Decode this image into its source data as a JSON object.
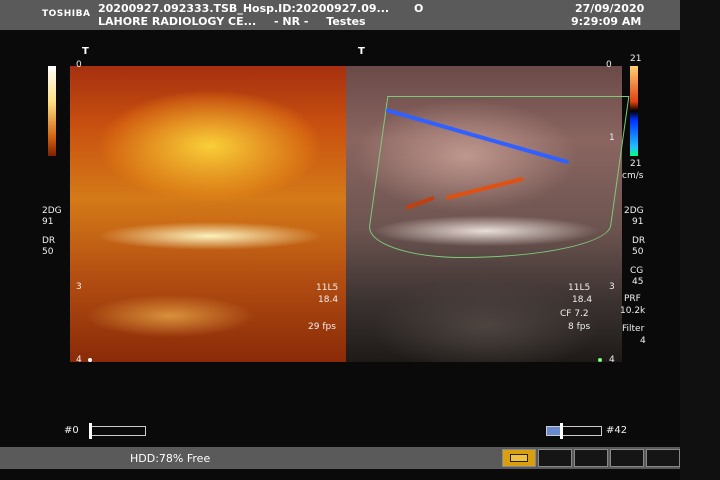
{
  "header": {
    "brand": "TOSHIBA",
    "file_line": "20200927.092333.TSB_Hosp.ID:20200927.09...",
    "hospital": "LAHORE RADIOLOGY CE...",
    "patient": "- NR -",
    "exam": "Testes",
    "indicator": "O",
    "date": "27/09/2020",
    "time": "9:29:09 AM"
  },
  "left_panel": {
    "t_mark": "T",
    "depth_top": "0",
    "depth_3": "3",
    "depth_4": "4",
    "gain": "2DG",
    "gain_value": "91",
    "dr": "DR",
    "dr_value": "50",
    "probe": "11L5",
    "depth_value": "18.4",
    "fps": "29 fps"
  },
  "right_panel": {
    "t_mark": "T",
    "depth_top": "0",
    "depth_1": "1",
    "depth_3": "3",
    "depth_4": "4",
    "scale_top": "21",
    "scale_bottom": "21",
    "scale_unit": "cm/s",
    "gain": "2DG",
    "gain_value": "91",
    "dr": "DR",
    "dr_value": "50",
    "cg": "CG",
    "cg_value": "45",
    "prf": "PRF",
    "prf_value": "10.2k",
    "filter": "Filter",
    "filter_value": "4",
    "probe": "11L5",
    "depth_value": "18.4",
    "cf": "CF 7.2",
    "fps": "8 fps"
  },
  "cine": {
    "left_frame": "#0",
    "right_frame": "#42",
    "right_position": 0.25
  },
  "footer": {
    "hdd": "HDD:78% Free"
  },
  "colors": {
    "header_bg": "#5a5a5a",
    "doppler_red": "#e04010",
    "doppler_blue": "#2050ff",
    "roi_green": "#7ccc7c"
  }
}
